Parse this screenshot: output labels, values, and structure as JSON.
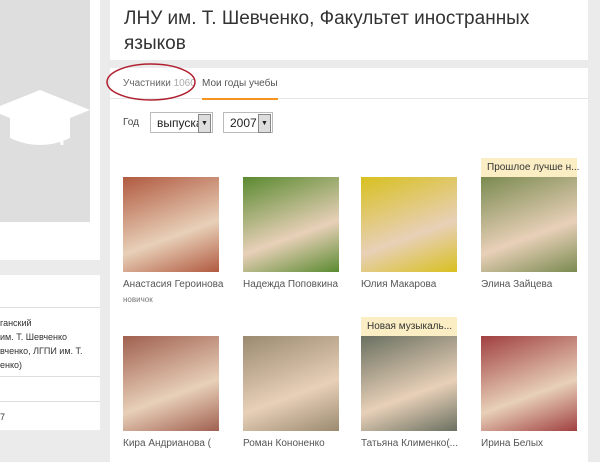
{
  "group_title": "ЛНУ им. Т. Шевченко, Факультет иностранных языков",
  "tabs": [
    {
      "label": "Участники",
      "count": "1060"
    },
    {
      "label": "Мои годы учебы"
    }
  ],
  "filter": {
    "label": "Год",
    "type_value": "выпуска",
    "year_value": "2007"
  },
  "sidebar": {
    "lines": [
      "ганский",
      "им. Т. Шевченко",
      "вченко, ЛГПИ им. Т.",
      "енко)"
    ],
    "footer": "7"
  },
  "members": [
    {
      "name": "Анастасия Героинова",
      "sub": "новичок",
      "color": "#b05a40"
    },
    {
      "name": "Надежда Поповкина",
      "color": "#5a8a30"
    },
    {
      "name": "Юлия Макарова",
      "color": "#d8c020"
    },
    {
      "name": "Элина Зайцева",
      "status": "Прошлое лучше н...",
      "color": "#7a8a50"
    },
    {
      "name": "Кира Андрианова (",
      "color": "#a06050"
    },
    {
      "name": "Роман Кононенко",
      "color": "#9a8a70"
    },
    {
      "name": "Татьяна Клименко(...",
      "status": "Новая музыкаль...",
      "color": "#6a7060"
    },
    {
      "name": "Ирина Белых",
      "color": "#a04040"
    }
  ],
  "accent": "#f7931e"
}
